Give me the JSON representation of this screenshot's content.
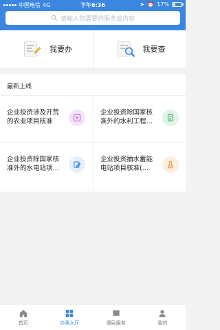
{
  "status": {
    "carrier": "中国电信",
    "network": "4G",
    "time": "下午6:36",
    "battery": "17%"
  },
  "search": {
    "placeholder": "请输入您需要的服务或内容"
  },
  "quick": {
    "left_label": "我要办",
    "right_label": "我要查"
  },
  "section": {
    "title": "最新上线",
    "items": [
      {
        "text": "企业投资涉及开荒的农业项目核准",
        "icon": "grid-icon",
        "color": "#d7a4e8",
        "bg": "#f4e3f8"
      },
      {
        "text": "企业投资除国家核准外的水利工程…",
        "icon": "document-icon",
        "color": "#49b66b",
        "bg": "#e2f3e7"
      },
      {
        "text": "企业投资除国家核准外的水电站项…",
        "icon": "edit-icon",
        "color": "#3b86e0",
        "bg": "#e6f0fd"
      },
      {
        "text": "企业投资抽水蓄能电站项目核准(…",
        "icon": "beaker-icon",
        "color": "#e29a4b",
        "bg": "#fbeede"
      }
    ]
  },
  "nav": {
    "items": [
      {
        "label": "首页",
        "icon": "home-icon"
      },
      {
        "label": "办事大厅",
        "icon": "apps-icon"
      },
      {
        "label": "便民服务",
        "icon": "book-icon"
      },
      {
        "label": "我的",
        "icon": "user-icon"
      }
    ],
    "active_index": 1,
    "active_color": "#3b86e0"
  }
}
